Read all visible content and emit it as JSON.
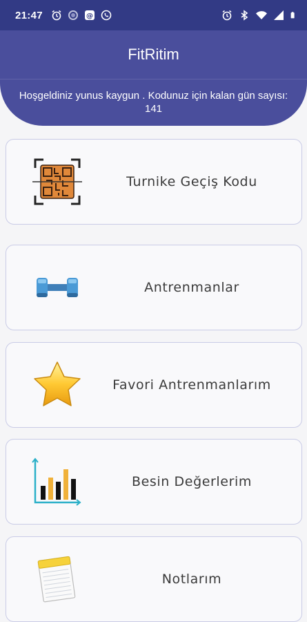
{
  "status_bar": {
    "time": "21:47",
    "left_icons": [
      "alarm-icon",
      "sync-icon",
      "threads-icon",
      "whatsapp-icon"
    ],
    "right_icons": [
      "alarm-icon",
      "bluetooth-icon",
      "wifi-icon",
      "signal-icon",
      "battery-icon"
    ]
  },
  "app_bar": {
    "title": "FitRitim"
  },
  "welcome": {
    "message": "Hoşgeldiniz yunus kaygun . Kodunuz için kalan gün sayısı: 141"
  },
  "menu": {
    "items": [
      {
        "label": "Turnike Geçiş Kodu",
        "icon": "qr-code-icon"
      },
      {
        "label": "Antrenmanlar",
        "icon": "dumbbell-icon"
      },
      {
        "label": "Favori Antrenmanlarım",
        "icon": "star-icon"
      },
      {
        "label": "Besin Değerlerim",
        "icon": "bar-chart-icon"
      },
      {
        "label": "Notlarım",
        "icon": "notepad-icon"
      }
    ]
  },
  "colors": {
    "status_bar": "#323a85",
    "primary": "#4a4e9c",
    "card_border": "#c9cbe6",
    "background": "#f5f5f7"
  }
}
